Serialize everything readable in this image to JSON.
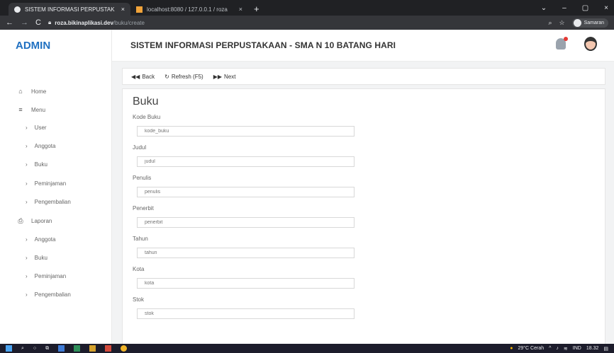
{
  "browser": {
    "tabs": [
      {
        "label": "SISTEM INFORMASI PERPUSTAK",
        "close": "×"
      },
      {
        "label": "localhost:8080 / 127.0.0.1 / roza",
        "close": "×"
      }
    ],
    "new_tab": "+",
    "url_host": "roza.bikinaplikasi.dev",
    "url_path": "/buku/create",
    "profile_name": "Samaran",
    "window_controls": [
      "⌄",
      "–",
      "▢",
      "×"
    ]
  },
  "sidebar": {
    "brand": "ADMIN",
    "home": "Home",
    "menu": "Menu",
    "menu_items": [
      "User",
      "Anggota",
      "Buku",
      "Peminjaman",
      "Pengembalian"
    ],
    "laporan": "Laporan",
    "laporan_items": [
      "Anggota",
      "Buku",
      "Peminjaman",
      "Pengembalian"
    ]
  },
  "header": {
    "title": "SISTEM INFORMASI PERPUSTAKAAN - SMA N 10 BATANG HARI"
  },
  "actions": {
    "back": "Back",
    "refresh": "Refresh (F5)",
    "next": "Next"
  },
  "form": {
    "title": "Buku",
    "fields": [
      {
        "label": "Kode Buku",
        "placeholder": "kode_buku"
      },
      {
        "label": "Judul",
        "placeholder": "judul"
      },
      {
        "label": "Penulis",
        "placeholder": "penulis"
      },
      {
        "label": "Penerbit",
        "placeholder": "penerbit"
      },
      {
        "label": "Tahun",
        "placeholder": "tahun"
      },
      {
        "label": "Kota",
        "placeholder": "kota"
      },
      {
        "label": "Stok",
        "placeholder": "stok"
      }
    ]
  },
  "taskbar": {
    "weather": "29°C  Cerah",
    "lang": "IND",
    "time": "18.32"
  },
  "colors": {
    "brand": "#1f70c1",
    "background": "#f2f3f4"
  }
}
